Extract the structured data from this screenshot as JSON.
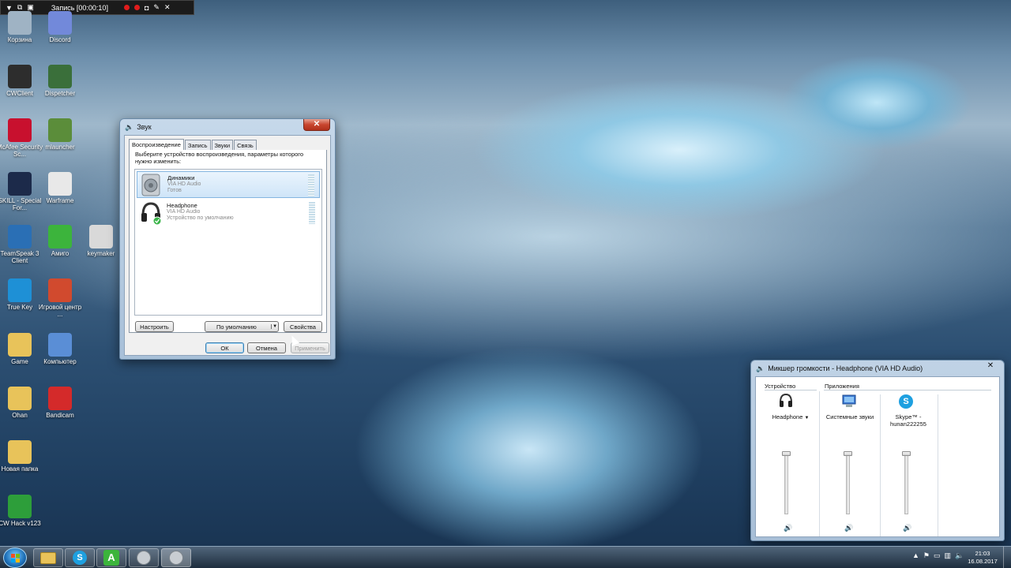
{
  "recorder": {
    "title": "Запись [00:00:10]"
  },
  "desktop_icons": [
    {
      "label": "Корзина",
      "icon": "recycle-bin-icon",
      "color": "#9fb3c4"
    },
    {
      "label": "Discord",
      "icon": "discord-icon",
      "color": "#7289da"
    },
    {
      "label": "CWClient",
      "icon": "cwclient-icon",
      "color": "#2d2d2d"
    },
    {
      "label": "Dispetcher",
      "icon": "dispetcher-icon",
      "color": "#3a6f3a"
    },
    {
      "label": "McAfee Security Sc...",
      "icon": "mcafee-icon",
      "color": "#c8102e"
    },
    {
      "label": "mlauncher",
      "icon": "minecraft-icon",
      "color": "#5b8d3a"
    },
    {
      "label": "SKILL - Special For...",
      "icon": "sf-icon",
      "color": "#1c2a4a"
    },
    {
      "label": "Warframe",
      "icon": "warframe-icon",
      "color": "#e8e8e8"
    },
    {
      "label": "TeamSpeak 3 Client",
      "icon": "teamspeak-icon",
      "color": "#2a6fb5"
    },
    {
      "label": "Амиго",
      "icon": "amigo-icon",
      "color": "#3cb43c"
    },
    {
      "label": "keymaker",
      "icon": "keymaker-icon",
      "color": "#d9d9d9"
    },
    {
      "label": "True Key",
      "icon": "truekey-icon",
      "color": "#1e90d6"
    },
    {
      "label": "Игровой центр ...",
      "icon": "game-center-icon",
      "color": "#d14a2e"
    },
    {
      "label": "Game",
      "icon": "folder-icon",
      "color": "#e8c35a"
    },
    {
      "label": "Компьютер",
      "icon": "computer-icon",
      "color": "#5a8ed6"
    },
    {
      "label": "Ohan",
      "icon": "folder-icon",
      "color": "#e8c35a"
    },
    {
      "label": "Bandicam",
      "icon": "bandicam-icon",
      "color": "#d42a2a"
    },
    {
      "label": "Новая папка",
      "icon": "folder-icon",
      "color": "#e8c35a"
    },
    {
      "label": "CW Hack v123",
      "icon": "cwhack-icon",
      "color": "#2d9e3a"
    }
  ],
  "sound_dialog": {
    "title": "Звук",
    "tabs": [
      "Воспроизведение",
      "Запись",
      "Звуки",
      "Связь"
    ],
    "instruction": "Выберите устройство воспроизведения, параметры которого нужно изменить:",
    "devices": [
      {
        "name": "Динамики",
        "driver": "VIA HD Audio",
        "status": "Готов"
      },
      {
        "name": "Headphone",
        "driver": "VIA HD Audio",
        "status": "Устройство по умолчанию"
      }
    ],
    "configure_label": "Настроить",
    "default_label": "По умолчанию",
    "properties_label": "Свойства",
    "ok_label": "ОК",
    "cancel_label": "Отмена",
    "apply_label": "Применить"
  },
  "mixer": {
    "title": "Микшер громкости - Headphone (VIA HD Audio)",
    "device_header": "Устройство",
    "apps_header": "Приложения",
    "channels": [
      {
        "label": "Headphone",
        "icon": "headphone-icon",
        "level": 1.0
      },
      {
        "label": "Системные звуки",
        "icon": "system-sounds-icon",
        "level": 1.0
      },
      {
        "label": "Skype™ - hunan222255",
        "icon": "skype-icon",
        "level": 1.0
      }
    ]
  },
  "taskbar": {
    "time": "21:03",
    "date": "16.08.2017",
    "apps": [
      "explorer-icon",
      "skype-icon",
      "amigo-icon",
      "sound-icon",
      "sound-icon"
    ]
  }
}
